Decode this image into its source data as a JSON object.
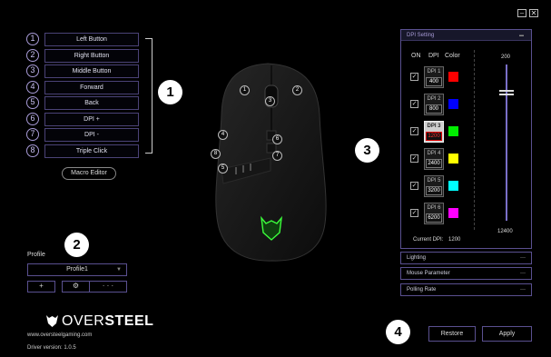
{
  "window": {
    "minimize_glyph": "–",
    "close_glyph": "✕"
  },
  "buttons": [
    {
      "num": "1",
      "label": "Left Button"
    },
    {
      "num": "2",
      "label": "Right Button"
    },
    {
      "num": "3",
      "label": "Middle Button"
    },
    {
      "num": "4",
      "label": "Forward"
    },
    {
      "num": "5",
      "label": "Back"
    },
    {
      "num": "6",
      "label": "DPI +"
    },
    {
      "num": "7",
      "label": "DPI -"
    },
    {
      "num": "8",
      "label": "Triple Click"
    }
  ],
  "macro_editor": "Macro Editor",
  "callouts": [
    "1",
    "2",
    "3",
    "4"
  ],
  "profile": {
    "label": "Profile",
    "selected": "Profile1",
    "add": "+",
    "settings": "⚙",
    "more": "· · ·"
  },
  "brand": {
    "name_light": "OVER",
    "name_bold": "STEEL",
    "website": "www.oversteelgaming.com",
    "driver": "Driver version: 1.0.5"
  },
  "dpi": {
    "title": "DPI Setting",
    "col_on": "ON",
    "col_dpi": "DPI",
    "col_color": "Color",
    "slider_max": "200",
    "slider_min": "12400",
    "stages": [
      {
        "name": "DPI 1",
        "value": "400",
        "color": "#ff0000",
        "checked": true,
        "active": false
      },
      {
        "name": "DPI 2",
        "value": "800",
        "color": "#0000ff",
        "checked": true,
        "active": false
      },
      {
        "name": "DPI 3",
        "value": "1200",
        "color": "#00ee00",
        "checked": true,
        "active": true
      },
      {
        "name": "DPI 4",
        "value": "2400",
        "color": "#ffff00",
        "checked": true,
        "active": false
      },
      {
        "name": "DPI 5",
        "value": "3200",
        "color": "#00ffff",
        "checked": true,
        "active": false
      },
      {
        "name": "DPI 6",
        "value": "6200",
        "color": "#ff00ff",
        "checked": true,
        "active": false
      }
    ],
    "current_label": "Current DPI:",
    "current_value": "1200",
    "check_glyph": "✓"
  },
  "sections": [
    {
      "label": "Lighting",
      "dash": "—"
    },
    {
      "label": "Mouse Parameter",
      "dash": "—"
    },
    {
      "label": "Polling Rate",
      "dash": "—"
    }
  ],
  "actions": {
    "restore": "Restore",
    "apply": "Apply"
  },
  "mouse_labels": [
    "1",
    "2",
    "3",
    "4",
    "5",
    "6",
    "7",
    "8"
  ]
}
